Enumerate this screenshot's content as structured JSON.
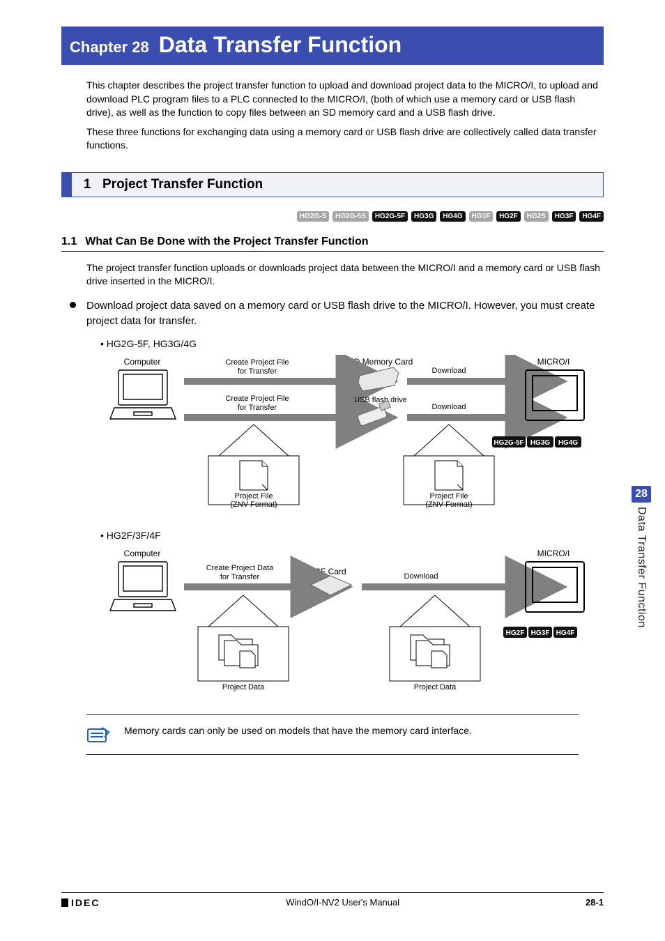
{
  "chapter": {
    "label": "Chapter 28",
    "title": "Data Transfer Function"
  },
  "intro": {
    "p1": "This chapter describes the project transfer function to upload and download project data to the MICRO/I, to upload and download PLC program files to a PLC connected to the MICRO/I, (both of which use a memory card or USB flash drive), as well as the function to copy files between an SD memory card and a USB flash drive.",
    "p2": "These three functions for exchanging data using a memory card or USB flash drive are collectively called data transfer functions."
  },
  "section": {
    "num": "1",
    "title": "Project Transfer Function"
  },
  "models_row": [
    {
      "label": "HG2G-S",
      "tone": "grey"
    },
    {
      "label": "HG2G-5S",
      "tone": "grey"
    },
    {
      "label": "HG2G-5F",
      "tone": "black"
    },
    {
      "label": "HG3G",
      "tone": "black"
    },
    {
      "label": "HG4G",
      "tone": "black"
    },
    {
      "label": "HG1F",
      "tone": "grey"
    },
    {
      "label": "HG2F",
      "tone": "black"
    },
    {
      "label": "HG2S",
      "tone": "grey"
    },
    {
      "label": "HG3F",
      "tone": "black"
    },
    {
      "label": "HG4F",
      "tone": "black"
    }
  ],
  "subsection": {
    "num": "1.1",
    "title": "What Can Be Done with the Project Transfer Function",
    "p1": "The project transfer function uploads or downloads project data between the MICRO/I and a memory card or USB flash drive inserted in the MICRO/I.",
    "bullet": "Download project data saved on a memory card or USB flash drive to the MICRO/I. However, you must create project data for transfer."
  },
  "diagA": {
    "sub": "• HG2G-5F, HG3G/4G",
    "computer": "Computer",
    "create1": "Create Project File\nfor Transfer",
    "create2": "Create Project File\nfor Transfer",
    "sd": "SD Memory Card",
    "usb": "USB flash drive",
    "download": "Download",
    "micro": "MICRO/I",
    "pfile": "Project File\n(ZNV Format)",
    "badges": [
      "HG2G-5F",
      "HG3G",
      "HG4G"
    ]
  },
  "diagB": {
    "sub": "• HG2F/3F/4F",
    "computer": "Computer",
    "create": "Create Project Data\nfor Transfer",
    "cf": "CF Card",
    "download": "Download",
    "micro": "MICRO/I",
    "pdata": "Project Data",
    "badges": [
      "HG2F",
      "HG3F",
      "HG4F"
    ]
  },
  "note": "Memory cards can only be used on models that have the memory card interface.",
  "sidetab": {
    "num": "28",
    "text": "Data Transfer Function"
  },
  "footer": {
    "brand": "IDEC",
    "center": "WindO/I-NV2 User's Manual",
    "page": "28-1"
  }
}
